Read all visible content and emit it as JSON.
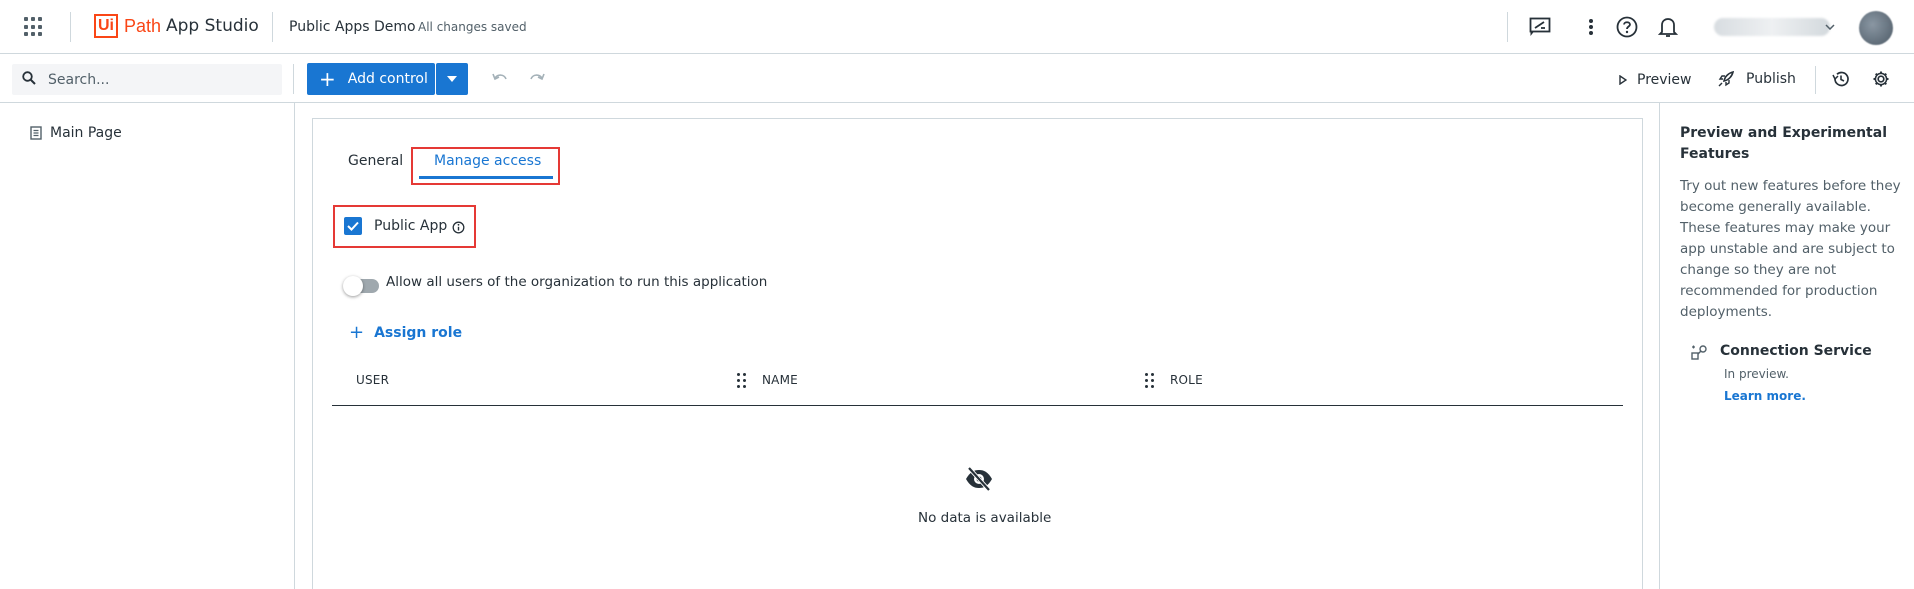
{
  "header": {
    "logo_ui": "Ui",
    "logo_path": "Path",
    "app_name": "App Studio",
    "project_name": "Public Apps Demo",
    "save_status": "All changes saved"
  },
  "toolbar": {
    "search_placeholder": "Search...",
    "add_control_label": "Add control",
    "preview_label": "Preview",
    "publish_label": "Publish"
  },
  "pages": [
    {
      "label": "Main Page"
    }
  ],
  "tabs": [
    {
      "label": "General",
      "active": false
    },
    {
      "label": "Manage access",
      "active": true
    }
  ],
  "access": {
    "public_app_label": "Public App",
    "public_app_checked": true,
    "allow_all_label": "Allow all users of the organization to run this application",
    "allow_all_enabled": false,
    "assign_role_label": "Assign role",
    "columns": [
      "USER",
      "NAME",
      "ROLE"
    ],
    "empty_text": "No data is available"
  },
  "right_panel": {
    "title": "Preview and Experimental Features",
    "description": "Try out new features before they become generally available. These features may make your app unstable and are subject to change so they are not recommended for production deployments.",
    "service_name": "Connection Service",
    "service_status": "In preview.",
    "service_link": "Learn more."
  },
  "colors": {
    "accent": "#1976d2",
    "brand": "#fa4616",
    "highlight": "#e53935",
    "text": "#273139",
    "border": "#cfd8dd"
  },
  "icons": [
    "apps-grid-icon",
    "feedback-icon",
    "more-vertical-icon",
    "help-icon",
    "bell-icon",
    "chevron-down-icon",
    "search-icon",
    "plus-icon",
    "undo-icon",
    "redo-icon",
    "play-icon",
    "rocket-icon",
    "history-icon",
    "gear-icon",
    "page-icon",
    "info-icon",
    "check-icon",
    "eye-off-icon",
    "connection-icon"
  ]
}
